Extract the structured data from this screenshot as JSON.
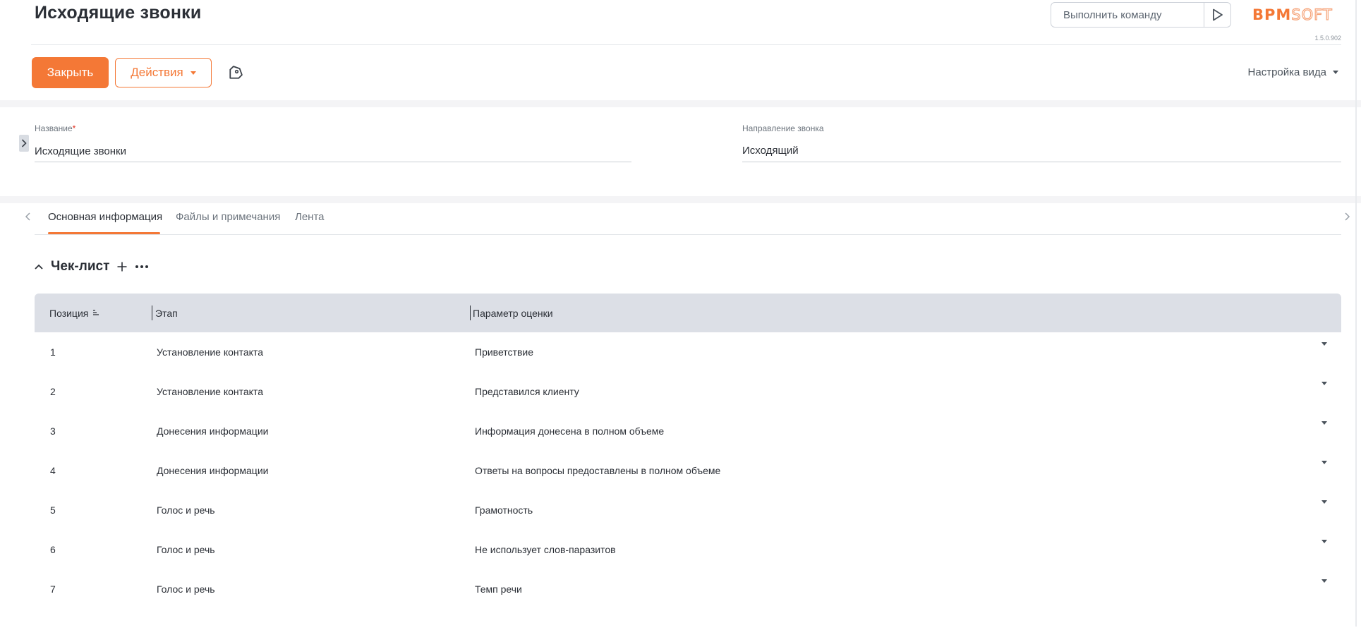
{
  "header": {
    "title": "Исходящие звонки",
    "command_placeholder": "Выполнить команду",
    "logo_bpm": "BPM",
    "logo_soft": "SOFT",
    "version": "1.5.0.902"
  },
  "toolbar": {
    "close_label": "Закрыть",
    "actions_label": "Действия",
    "view_settings_label": "Настройка вида"
  },
  "form": {
    "name_label": "Название",
    "name_required_mark": "*",
    "name_value": "Исходящие звонки",
    "direction_label": "Направление звонка",
    "direction_value": "Исходящий"
  },
  "tabs": [
    {
      "label": "Основная информация",
      "active": true
    },
    {
      "label": "Файлы и примечания",
      "active": false
    },
    {
      "label": "Лента",
      "active": false
    }
  ],
  "checklist": {
    "title": "Чек-лист",
    "columns": [
      "Позиция",
      "Этап",
      "Параметр оценки"
    ],
    "rows": [
      {
        "position": "1",
        "stage": "Установление контакта",
        "parameter": "Приветствие"
      },
      {
        "position": "2",
        "stage": "Установление контакта",
        "parameter": "Представился клиенту"
      },
      {
        "position": "3",
        "stage": "Донесения информации",
        "parameter": "Информация донесена в полном объеме"
      },
      {
        "position": "4",
        "stage": "Донесения информации",
        "parameter": "Ответы на вопросы предоставлены в полном объеме"
      },
      {
        "position": "5",
        "stage": "Голос и речь",
        "parameter": "Грамотность"
      },
      {
        "position": "6",
        "stage": "Голос и речь",
        "parameter": "Не использует слов-паразитов"
      },
      {
        "position": "7",
        "stage": "Голос и речь",
        "parameter": "Темп речи"
      }
    ]
  },
  "icons": {
    "run": "play-outline-icon",
    "tag": "tag-icon",
    "panel_toggle": "chevron-right-icon",
    "collapse": "chevron-up-icon",
    "add": "plus-icon",
    "more": "more-horizontal-icon",
    "sort": "sort-ascending-icon",
    "row_menu": "caret-down-icon"
  },
  "colors": {
    "accent": "#f47836",
    "header_bg": "#dcdfe6",
    "required": "#e0301e"
  }
}
